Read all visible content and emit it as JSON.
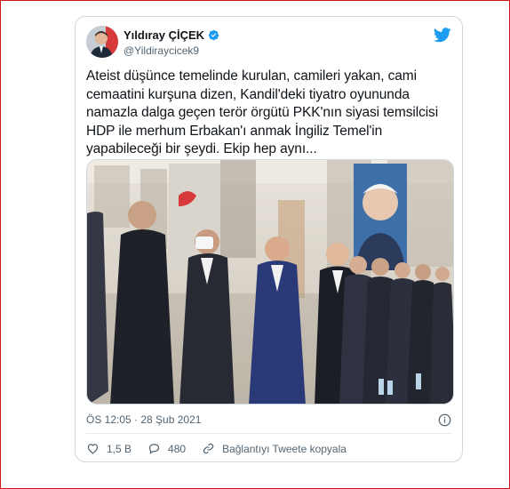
{
  "tweet": {
    "display_name": "Yıldıray ÇİÇEK",
    "handle": "@Yildiraycicek9",
    "text": "Ateist düşünce temelinde kurulan, camileri yakan, cami cemaatini kurşuna dizen, Kandil'deki tiyatro oyununda namazla dalga geçen terör örgütü PKK'nın siyasi temsilcisi HDP ile merhum Erbakan'ı anmak İngiliz Temel'in yapabileceği bir şeydi. Ekip hep aynı...",
    "timestamp": "ÖS 12:05 · 28 Şub 2021",
    "likes": "1,5 B",
    "replies": "480",
    "copy_link_label": "Bağlantıyı Tweete kopyala"
  },
  "icons": {
    "verified": "verified-badge-icon",
    "bird": "twitter-bird-icon",
    "info": "info-icon",
    "like": "heart-icon",
    "reply": "reply-bubble-icon",
    "copy_link": "link-icon"
  },
  "colors": {
    "brand_blue": "#1d9bf0",
    "text": "#0f1419",
    "secondary_text": "#536471",
    "border": "#cfd9de",
    "page_frame": "#d0161a"
  }
}
